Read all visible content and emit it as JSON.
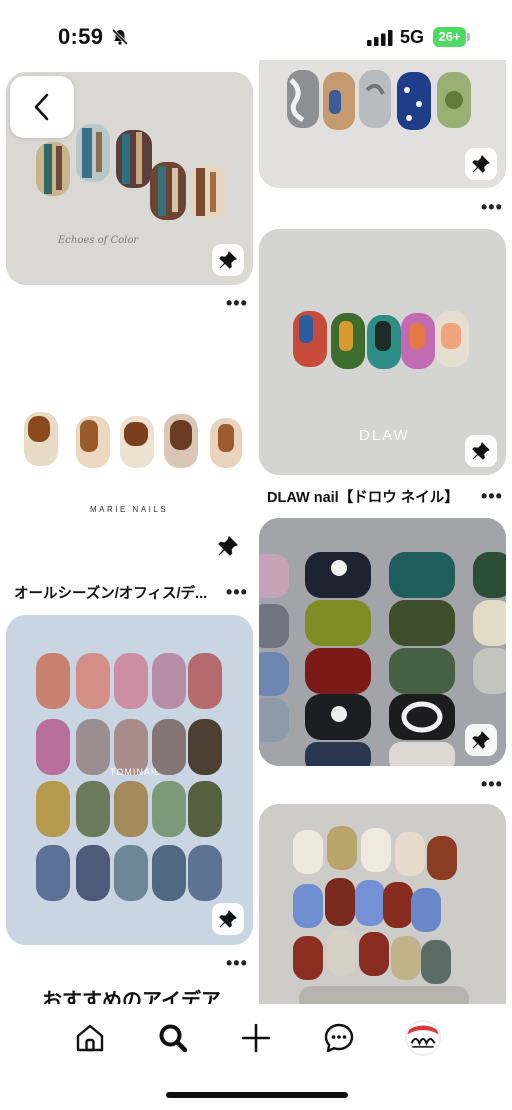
{
  "status_bar": {
    "time": "0:59",
    "network": "5G",
    "battery": "26+"
  },
  "icons": {
    "back": "chevron-left-icon",
    "pin": "pushpin-icon",
    "home": "home-icon",
    "search": "search-icon",
    "create": "plus-icon",
    "messages": "chat-bubble-icon",
    "profile": "avatar"
  },
  "pins": [
    {
      "id": "echoes",
      "watermark": "Echoes of Color",
      "more": "•••"
    },
    {
      "id": "top-right",
      "more": "•••"
    },
    {
      "id": "marie",
      "watermark": "MARIE NAILS",
      "caption": "オールシーズン/オフィス/デ...",
      "more": "•••"
    },
    {
      "id": "dlaw",
      "watermark": "DLAW",
      "caption": "DLAW nail【ドロウ ネイル】",
      "more": "•••"
    },
    {
      "id": "tominail",
      "watermark": "TOMINAIL",
      "more": "•••"
    },
    {
      "id": "grid-right",
      "more": "•••"
    },
    {
      "id": "bottom-right"
    }
  ],
  "section_title": "おすすめのアイデア",
  "colors": {
    "battery_green": "#4cd964",
    "card_bg_grey": "#d6d6d4",
    "card_bg_blue": "#c7d4e2",
    "text": "#111111"
  }
}
